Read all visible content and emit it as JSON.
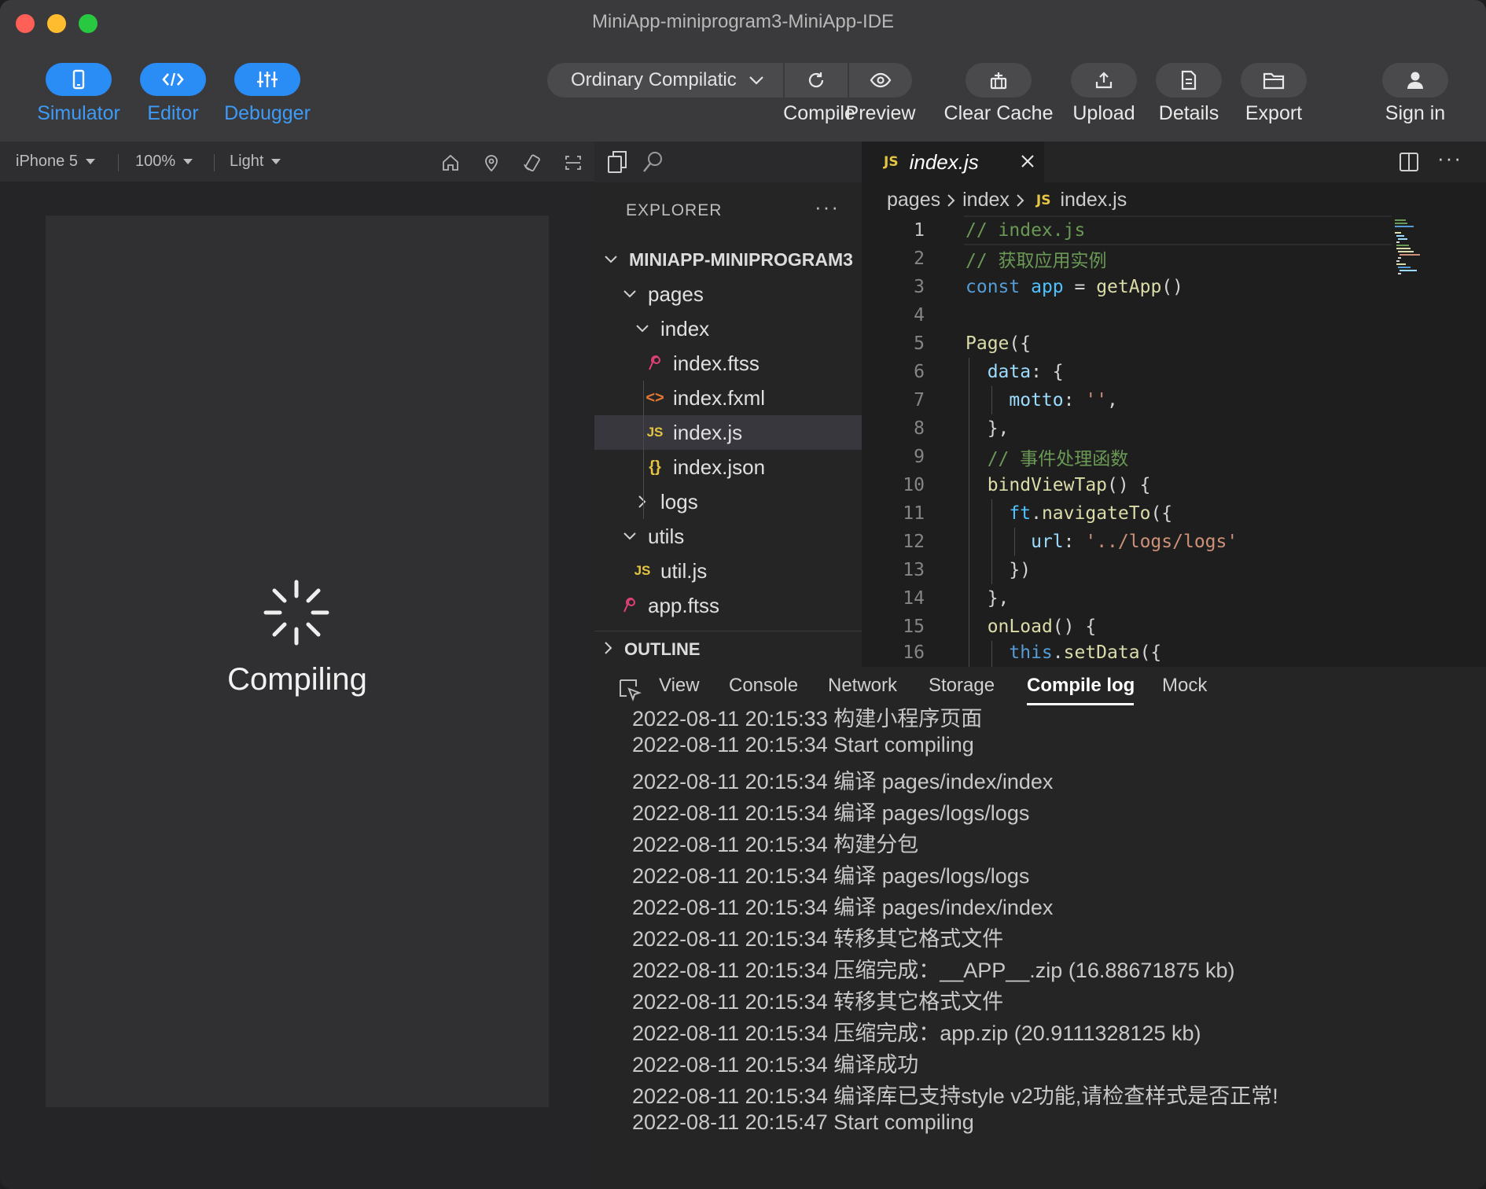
{
  "window": {
    "title": "MiniApp-miniprogram3-MiniApp-IDE"
  },
  "toolbar": {
    "modes": [
      {
        "label": "Simulator",
        "icon": "phone-icon"
      },
      {
        "label": "Editor",
        "icon": "code-icon"
      },
      {
        "label": "Debugger",
        "icon": "sliders-icon"
      }
    ],
    "compile_mode": "Ordinary Compilatic",
    "compile_label": "Compile",
    "preview_label": "Preview",
    "clear_cache_label": "Clear Cache",
    "upload_label": "Upload",
    "details_label": "Details",
    "export_label": "Export",
    "sign_in_label": "Sign in",
    "accent": "#2a8cf5"
  },
  "simulator": {
    "device": "iPhone 5",
    "zoom": "100%",
    "theme": "Light",
    "status": "Compiling"
  },
  "explorer": {
    "title": "EXPLORER",
    "project": "MINIAPP-MINIPROGRAM3",
    "items": [
      {
        "label": "pages",
        "type": "folder",
        "expanded": true
      },
      {
        "label": "index",
        "type": "folder",
        "expanded": true
      },
      {
        "label": "index.ftss",
        "type": "style"
      },
      {
        "label": "index.fxml",
        "type": "markup"
      },
      {
        "label": "index.js",
        "type": "js",
        "selected": true
      },
      {
        "label": "index.json",
        "type": "json"
      },
      {
        "label": "logs",
        "type": "folder",
        "expanded": false
      },
      {
        "label": "utils",
        "type": "folder",
        "expanded": true
      },
      {
        "label": "util.js",
        "type": "js"
      },
      {
        "label": "app.ftss",
        "type": "style"
      }
    ],
    "outline_label": "OUTLINE"
  },
  "editor": {
    "tab_label": "index.js",
    "breadcrumb": [
      "pages",
      "index",
      "index.js"
    ],
    "line_numbers": [
      "1",
      "2",
      "3",
      "4",
      "5",
      "6",
      "7",
      "8",
      "9",
      "10",
      "11",
      "12",
      "13",
      "14",
      "15",
      "16"
    ],
    "code": {
      "l1": "// index.js",
      "l2": "// 获取应用实例",
      "l3_kw": "const",
      "l3_var": "app",
      "l3_eq": " = ",
      "l3_fn": "getApp",
      "l3_tail": "()",
      "l5_fn": "Page",
      "l5_tail": "({",
      "l6_prop": "data",
      "l6_tail": ": {",
      "l7_prop": "motto",
      "l7_mid": ": ",
      "l7_str": "''",
      "l7_tail": ",",
      "l8": "},",
      "l9": "// 事件处理函数",
      "l10_fn": "bindViewTap",
      "l10_tail": "() {",
      "l11_obj": "ft",
      "l11_dot": ".",
      "l11_fn": "navigateTo",
      "l11_tail": "({",
      "l12_prop": "url",
      "l12_mid": ": ",
      "l12_str": "'../logs/logs'",
      "l13": "})",
      "l14": "},",
      "l15_fn": "onLoad",
      "l15_tail": "() {",
      "l16_kw": "this",
      "l16_dot": ".",
      "l16_fn": "setData",
      "l16_tail": "({"
    }
  },
  "debugger": {
    "tabs": [
      "View",
      "Console",
      "Network",
      "Storage",
      "Compile log",
      "Mock"
    ],
    "active_tab": "Compile log",
    "log": [
      "2022-08-11 20:15:33 构建小程序页面",
      "2022-08-11 20:15:34 Start compiling",
      "2022-08-11 20:15:34 编译 pages/index/index",
      "2022-08-11 20:15:34 编译 pages/logs/logs",
      "2022-08-11 20:15:34 构建分包",
      "2022-08-11 20:15:34 编译 pages/logs/logs",
      "2022-08-11 20:15:34 编译 pages/index/index",
      "2022-08-11 20:15:34 转移其它格式文件",
      "2022-08-11 20:15:34 压缩完成：__APP__.zip (16.88671875 kb)",
      "2022-08-11 20:15:34 转移其它格式文件",
      "2022-08-11 20:15:34 压缩完成：app.zip (20.9111328125 kb)",
      "2022-08-11 20:15:34 编译成功",
      "2022-08-11 20:15:34 编译库已支持style v2功能,请检查样式是否正常!",
      "2022-08-11 20:15:47 Start compiling"
    ]
  }
}
